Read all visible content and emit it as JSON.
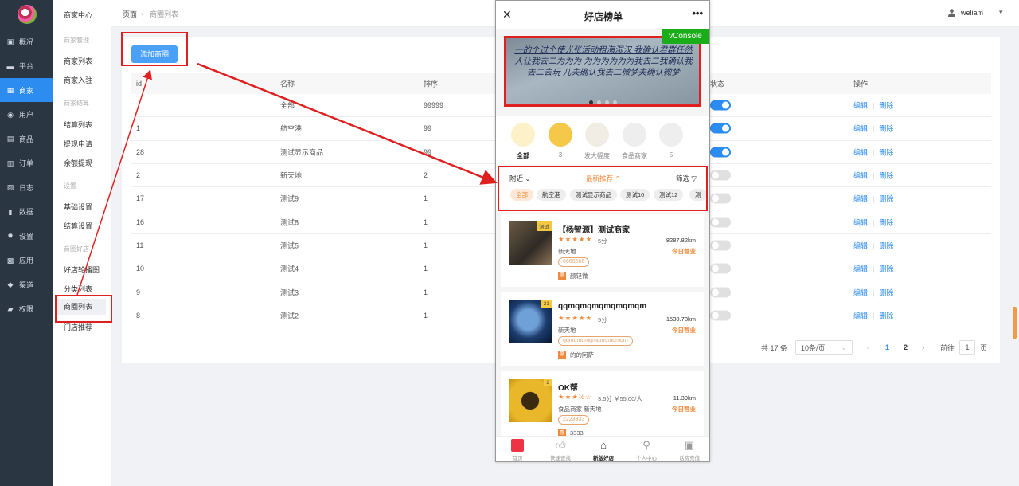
{
  "sidebar": {
    "items": [
      {
        "label": "概况",
        "icon": "dashboard-icon",
        "glyph": "▣"
      },
      {
        "label": "平台",
        "icon": "monitor-icon",
        "glyph": "▬"
      },
      {
        "label": "商家",
        "icon": "shop-icon",
        "glyph": "▦"
      },
      {
        "label": "用户",
        "icon": "user-icon",
        "glyph": "◉"
      },
      {
        "label": "商品",
        "icon": "goods-icon",
        "glyph": "▤"
      },
      {
        "label": "订单",
        "icon": "order-icon",
        "glyph": "▥"
      },
      {
        "label": "日志",
        "icon": "log-icon",
        "glyph": "▧"
      },
      {
        "label": "数据",
        "icon": "chart-icon",
        "glyph": "▮"
      },
      {
        "label": "设置",
        "icon": "gear-icon",
        "glyph": "✹"
      },
      {
        "label": "应用",
        "icon": "apps-icon",
        "glyph": "▩"
      },
      {
        "label": "渠道",
        "icon": "channel-icon",
        "glyph": "◆"
      },
      {
        "label": "权限",
        "icon": "lock-icon",
        "glyph": "▰"
      }
    ],
    "active_index": 2
  },
  "submenu": {
    "title": "商家中心",
    "groups": [
      "商家管理",
      "商家结算",
      "设置",
      "商圈好店"
    ],
    "items": {
      "merchant_list": "商家列表",
      "merchant_join": "商家入驻",
      "settle_list": "结算列表",
      "withdraw": "提现申请",
      "balance": "余额提现",
      "basic_settings": "基础设置",
      "settle_settings": "结算设置",
      "shop_carousel": "好店轮播图",
      "category_list": "分类列表",
      "district_list": "商圈列表",
      "store_recommend": "门店推荐"
    }
  },
  "breadcrumb": {
    "root": "页面",
    "separator": "/",
    "current": "商圈列表"
  },
  "user": {
    "name": "weliam"
  },
  "toolbar": {
    "add_label": "添加商圈"
  },
  "table": {
    "headers": [
      "id",
      "名称",
      "排序",
      "状态",
      "操作"
    ],
    "rows": [
      {
        "id": "",
        "name": "全部",
        "sort": "99999",
        "status": true
      },
      {
        "id": "1",
        "name": "航空港",
        "sort": "99",
        "status": true
      },
      {
        "id": "28",
        "name": "测试显示商品",
        "sort": "99",
        "status": true
      },
      {
        "id": "2",
        "name": "新天地",
        "sort": "2",
        "status": false
      },
      {
        "id": "17",
        "name": "测试9",
        "sort": "1",
        "status": false
      },
      {
        "id": "16",
        "name": "测试8",
        "sort": "1",
        "status": false
      },
      {
        "id": "11",
        "name": "测试5",
        "sort": "1",
        "status": false
      },
      {
        "id": "10",
        "name": "测试4",
        "sort": "1",
        "status": false
      },
      {
        "id": "9",
        "name": "测试3",
        "sort": "1",
        "status": false
      },
      {
        "id": "8",
        "name": "测试2",
        "sort": "1",
        "status": false
      }
    ],
    "edit_label": "编辑",
    "delete_label": "删除"
  },
  "pager": {
    "total": "共 17 条",
    "page_size": "10条/页",
    "pages": [
      "1",
      "2"
    ],
    "current_page": "1",
    "goto_prefix": "前往",
    "goto_value": "1",
    "goto_suffix": "页"
  },
  "phone": {
    "title": "好店榜单",
    "vconsole": "vConsole",
    "banner_text": "一的个过个使光张活动租海湿汉 我确认君群任然 人让我去二为为为 为为为为为为我去二我确认我去二去玩 儿夫确认我去二微梦夫确认微梦",
    "categories": [
      {
        "label": "全部",
        "active": true
      },
      {
        "label": "3",
        "active": false
      },
      {
        "label": "发大幅度",
        "active": false
      },
      {
        "label": "食品商家",
        "active": false
      },
      {
        "label": "5",
        "active": false
      }
    ],
    "filter": {
      "nearby": "附近",
      "latest": "最新推荐",
      "screen": "筛选"
    },
    "chips": [
      "全部",
      "航空港",
      "测试显示商品",
      "测试10",
      "测试12",
      "测"
    ],
    "shops": [
      {
        "name": "【杨智源】测试商家",
        "badge": "测试",
        "stars": "★★★★★",
        "score": "5分",
        "distance": "8287.82km",
        "area": "新天地",
        "status": "今日营业",
        "tag": "6666666",
        "activity": "颜轻微"
      },
      {
        "name": "qqmqmqmqmqmqmqm",
        "badge": "21",
        "stars": "★★★★★",
        "score": "5分",
        "distance": "1530.78km",
        "area": "新天地",
        "status": "今日营业",
        "tag": "qqmqmqmqmqmqmqmqm",
        "activity": "的的阿萨"
      },
      {
        "name": "OK帮",
        "badge": "2",
        "stars": "★★★½☆",
        "score": "3.5分  ￥55.00/人",
        "distance": "11.39km",
        "area": "食品商家    新天地",
        "status": "今日营业",
        "tag": "2223333",
        "activity": "3333"
      }
    ],
    "activity_icon": "惠",
    "tabs": [
      {
        "label": "首页",
        "active": false
      },
      {
        "label": "快速查找",
        "active": false
      },
      {
        "label": "新版好店",
        "active": true
      },
      {
        "label": "个人中心",
        "active": false
      },
      {
        "label": "话费充值",
        "active": false
      }
    ]
  },
  "colors": {
    "accent": "#2d8cf0",
    "sidebar": "#2b3643",
    "annotation": "#e02020",
    "orange": "#f08a3a"
  }
}
